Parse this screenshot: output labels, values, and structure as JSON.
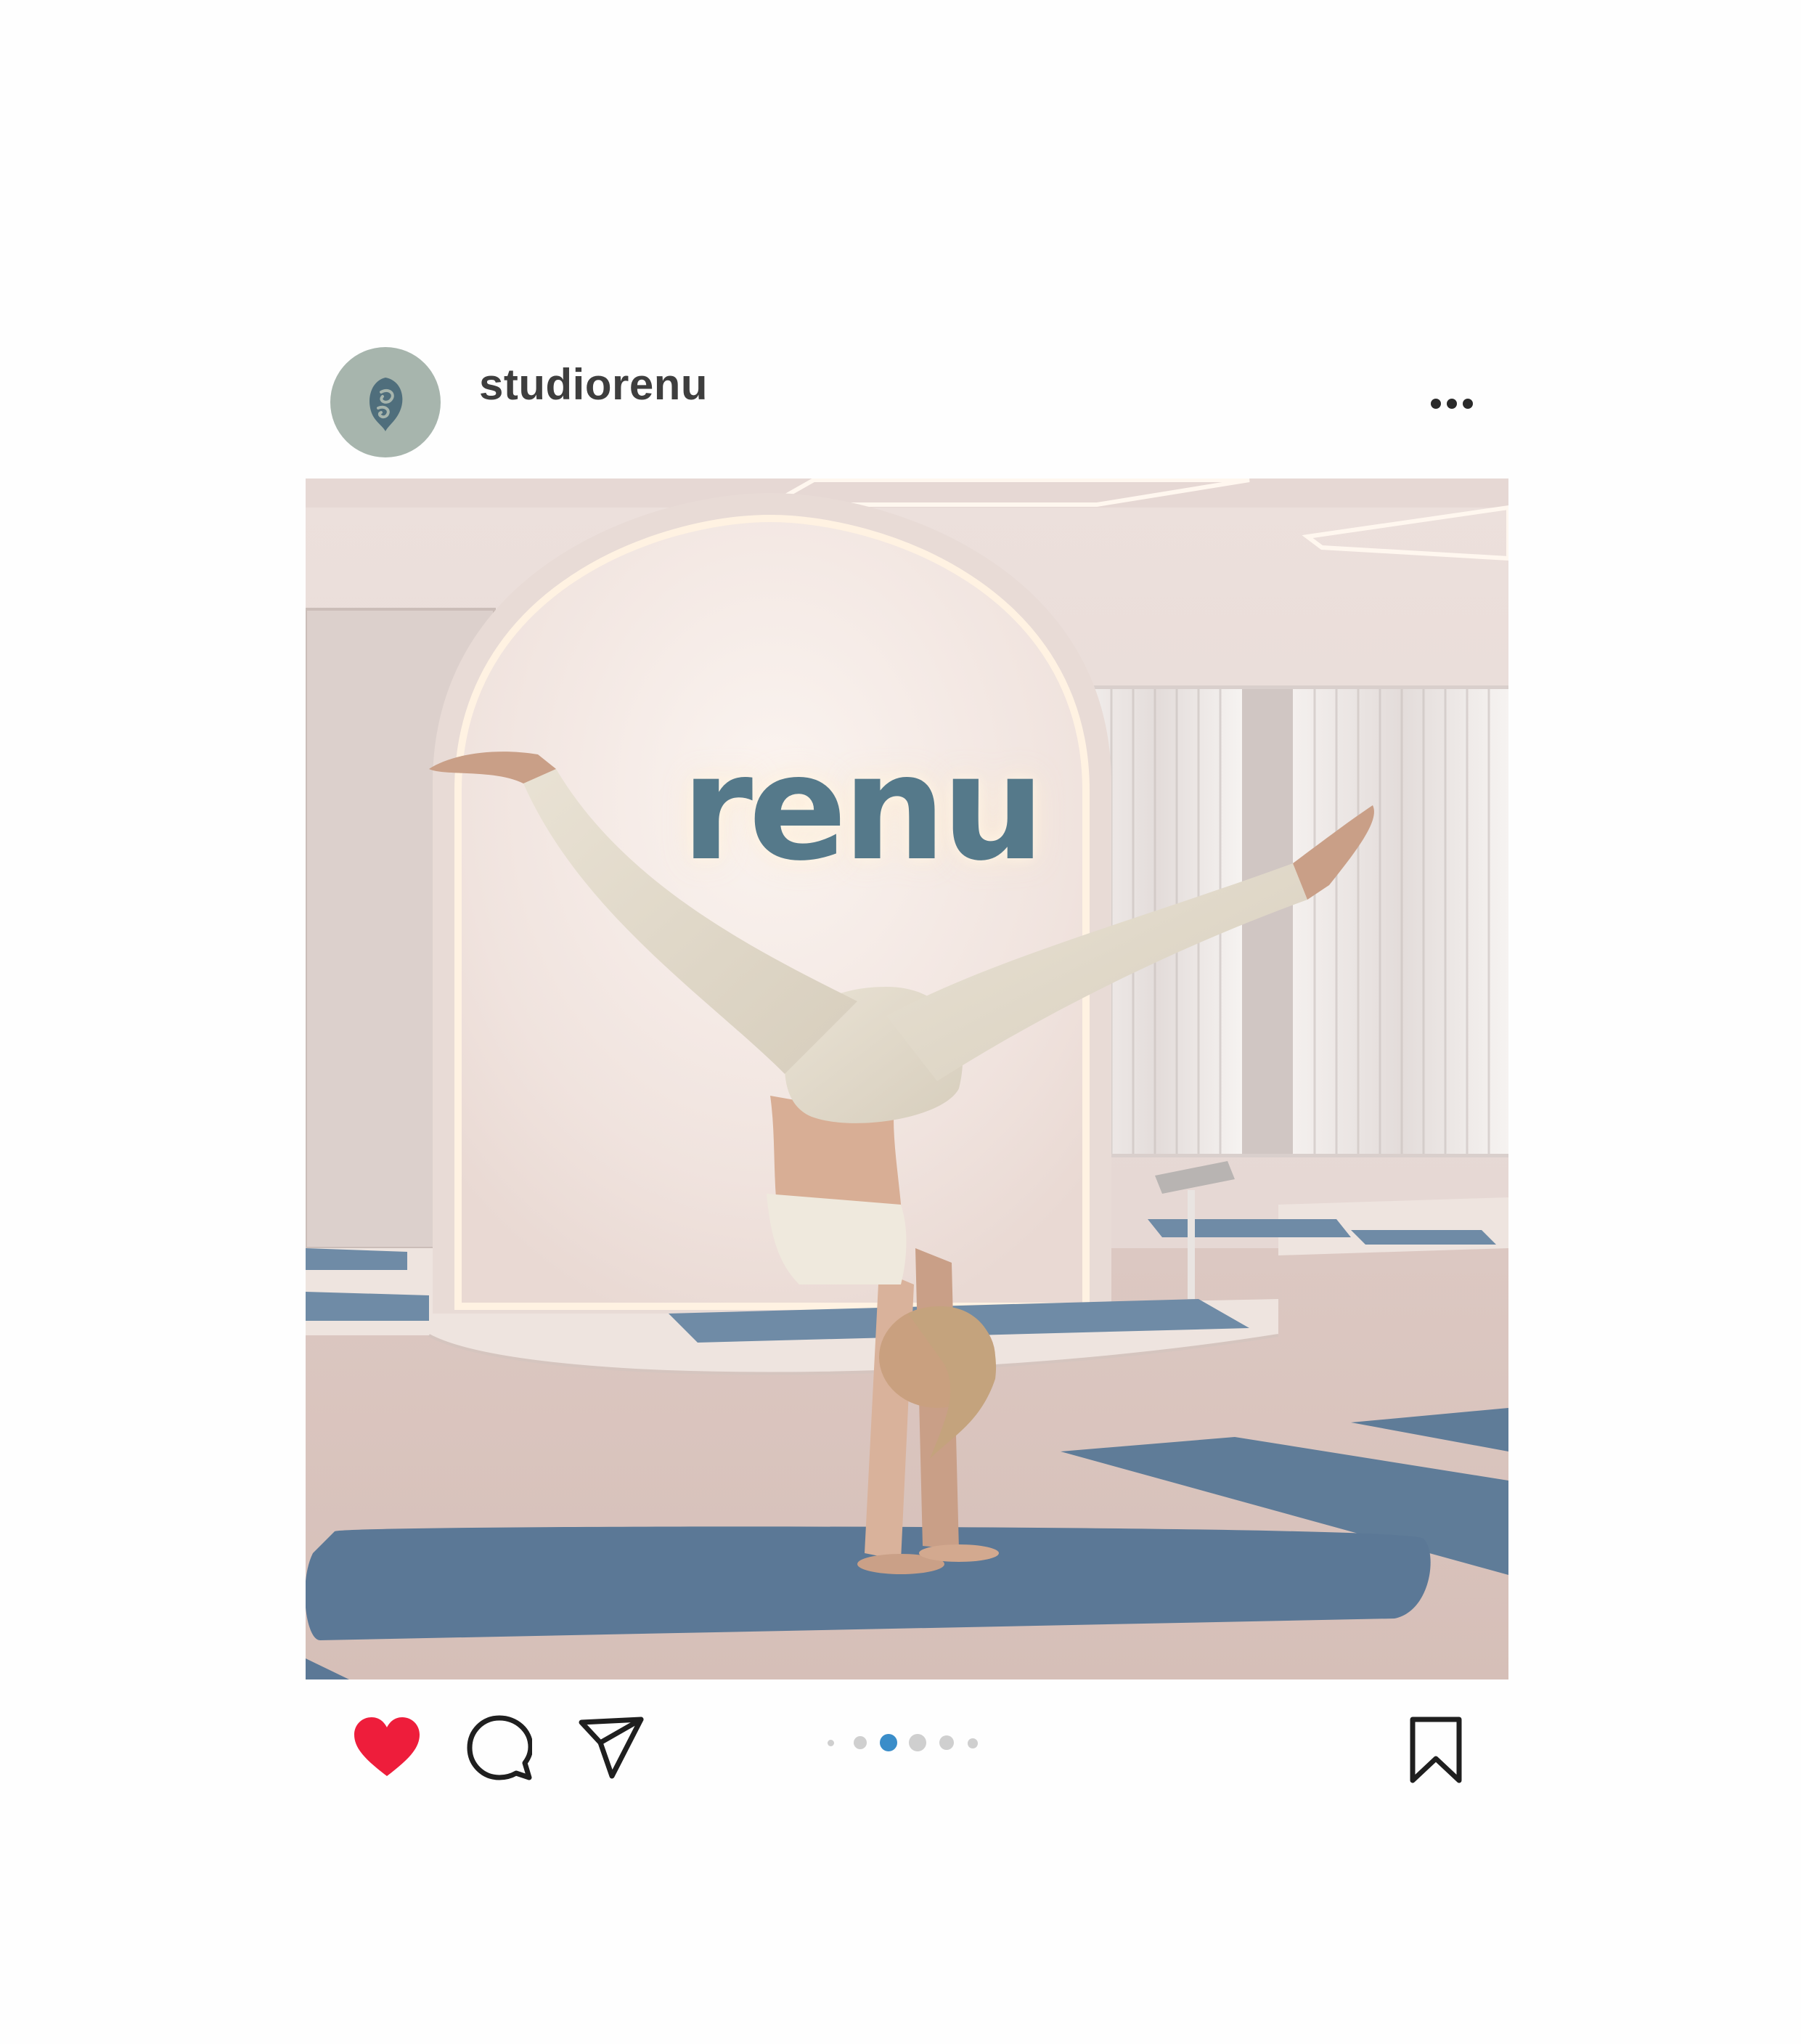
{
  "post": {
    "username": "studiorenu",
    "avatar_icon": "leaf-swirl-logo-icon",
    "more_icon": "more-options-icon",
    "photo": {
      "sign_text": "renu",
      "description": "photo"
    },
    "actions": {
      "like_icon": "heart-filled-icon",
      "comment_icon": "comment-bubble-icon",
      "share_icon": "paper-plane-icon",
      "save_icon": "bookmark-icon"
    },
    "carousel": {
      "total_dots": 6,
      "active_index": 3
    }
  },
  "colors": {
    "like": "#ee1d3b",
    "active_dot": "#3a8dc9",
    "avatar_bg": "#a7b5ad",
    "sign": "#55798a"
  }
}
